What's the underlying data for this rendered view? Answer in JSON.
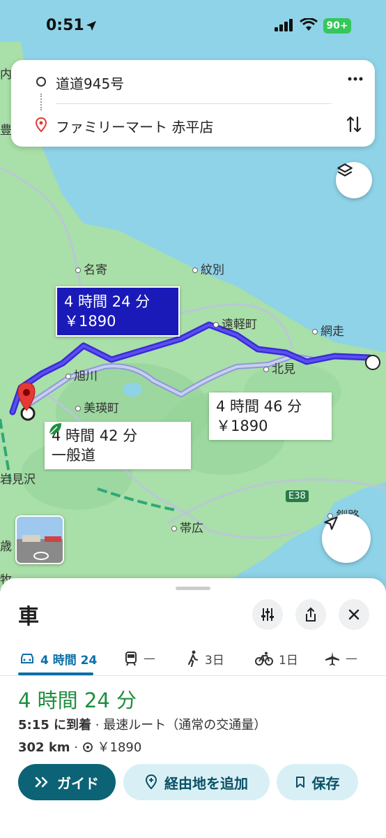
{
  "status_bar": {
    "time": "0:51",
    "battery": "90+"
  },
  "search": {
    "origin": "道道945号",
    "destination": "ファミリーマート 赤平店"
  },
  "map": {
    "labels": {
      "nai": "内",
      "toyo": "豊",
      "nayoro": "名寄",
      "monbetsu": "紋別",
      "engaru": "遠軽町",
      "abashiri": "網走",
      "kitami": "北見",
      "asahikawa": "旭川",
      "biei": "美瑛町",
      "iwamizawa": "岩見沢",
      "obihiro": "帯広",
      "kushiro": "釧路",
      "highway": "E38",
      "sai": "歳",
      "maki": "牧"
    },
    "routes": {
      "primary": {
        "time": "4 時間 24 分",
        "fare": "￥1890"
      },
      "alt1": {
        "time": "4 時間 46 分",
        "fare": "￥1890"
      },
      "alt2": {
        "time": "4 時間 42 分",
        "note": "一般道"
      }
    }
  },
  "sheet": {
    "title": "車",
    "modes": [
      {
        "label": "4 時間 24",
        "icon": "car-icon"
      },
      {
        "label": "—",
        "icon": "train-icon"
      },
      {
        "label": "3日",
        "icon": "walk-icon"
      },
      {
        "label": "1日",
        "icon": "bike-icon"
      },
      {
        "label": "—",
        "icon": "plane-icon"
      }
    ],
    "duration": "4 時間 24 分",
    "arrival_bold": "5:15 に到着",
    "arrival_rest": " · 最速ルート（通常の交通量）",
    "distance": "302 km",
    "fare": "￥1890",
    "buttons": {
      "guide": "ガイド",
      "add_stop": "経由地を追加",
      "save": "保存"
    }
  },
  "colors": {
    "route_primary": "#3a2bd6",
    "route_alt": "#8e9ad8",
    "accent": "#0b6375",
    "duration": "#1e8e3e"
  }
}
